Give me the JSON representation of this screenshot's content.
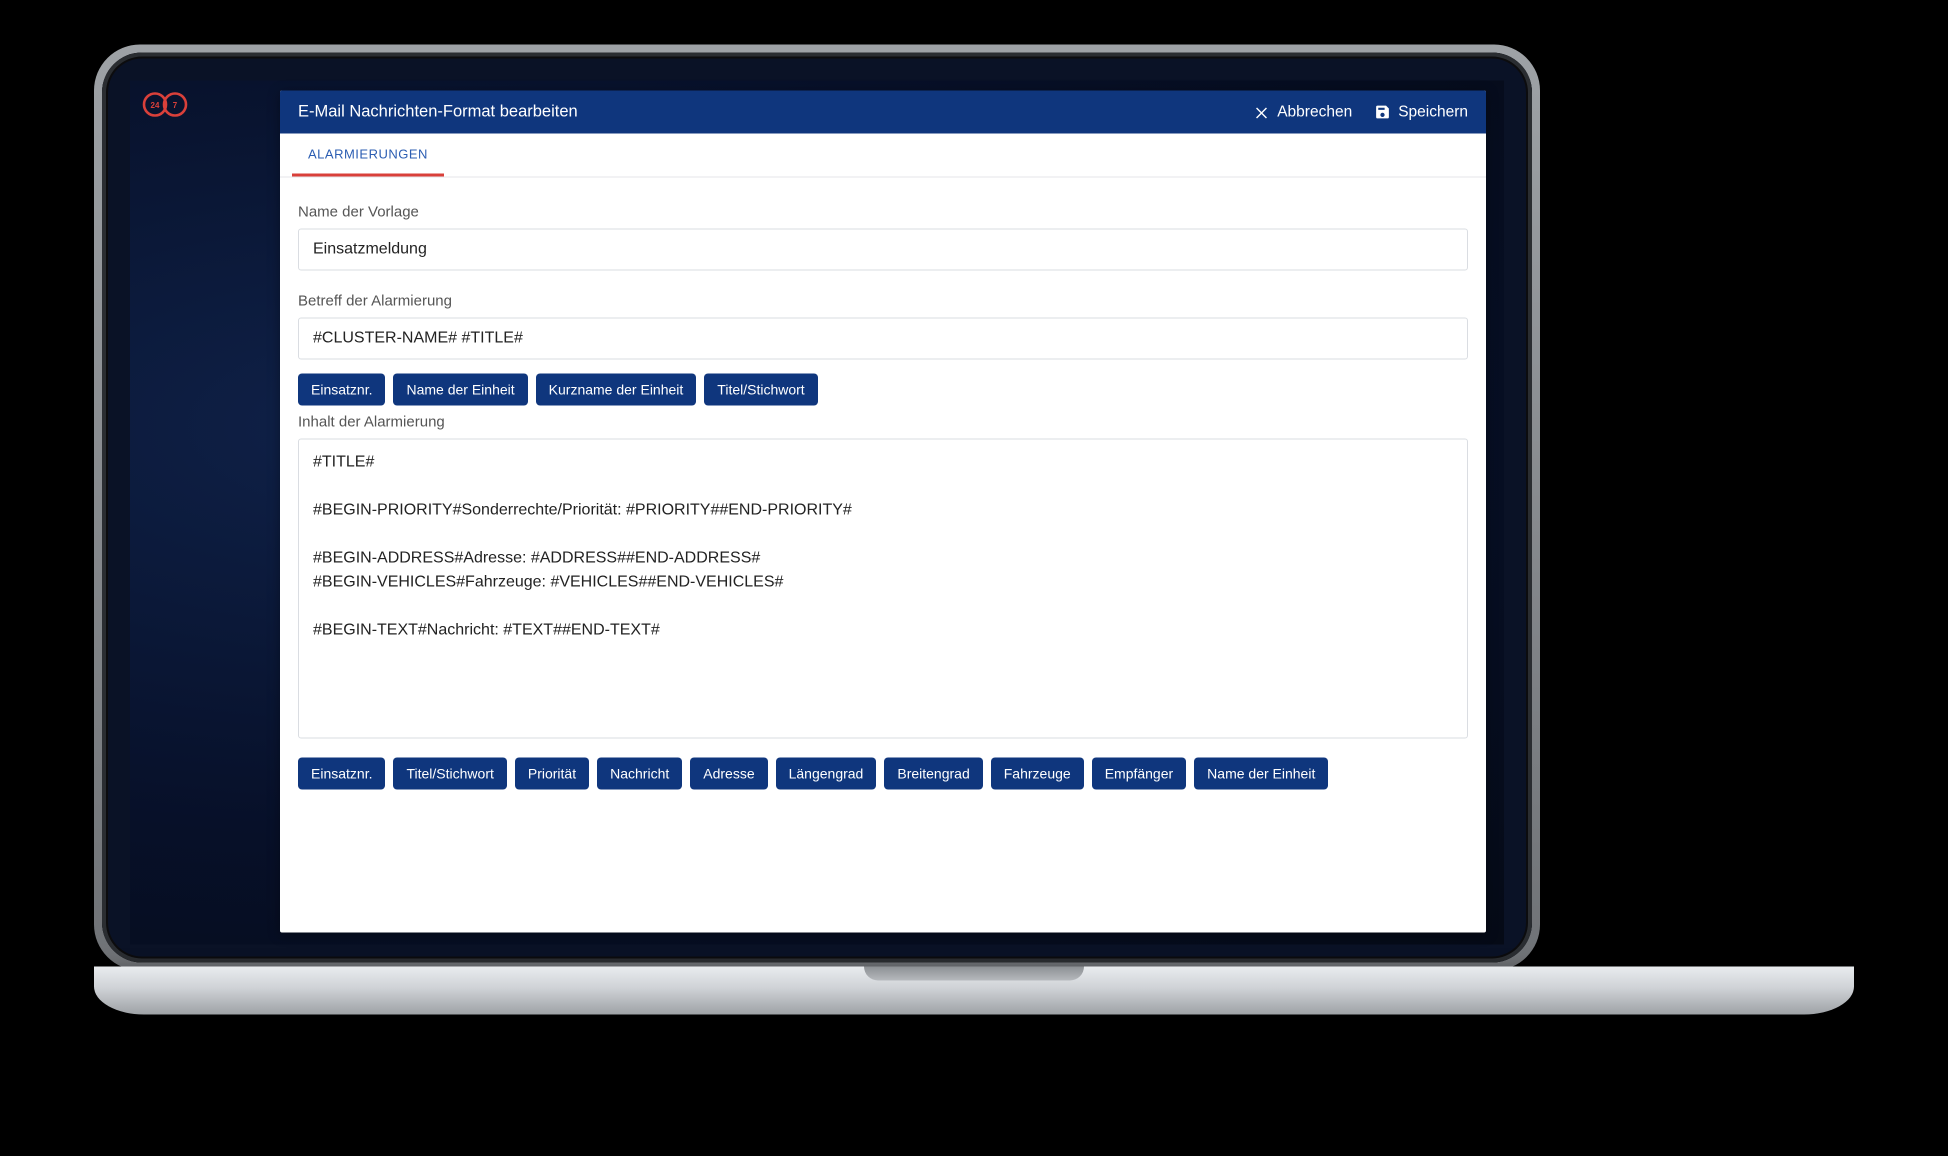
{
  "header": {
    "title": "E-Mail Nachrichten-Format bearbeiten",
    "cancel_label": "Abbrechen",
    "save_label": "Speichern"
  },
  "tabs": {
    "alarmierungen": "ALARMIERUNGEN"
  },
  "form": {
    "template_name_label": "Name der Vorlage",
    "template_name_value": "Einsatzmeldung",
    "subject_label": "Betreff der Alarmierung",
    "subject_value": "#CLUSTER-NAME# #TITLE#",
    "content_label": "Inhalt der Alarmierung",
    "content_value": "#TITLE#\n\n#BEGIN-PRIORITY#Sonderrechte/Priorität: #PRIORITY##END-PRIORITY#\n\n#BEGIN-ADDRESS#Adresse: #ADDRESS##END-ADDRESS#\n#BEGIN-VEHICLES#Fahrzeuge: #VEHICLES##END-VEHICLES#\n\n#BEGIN-TEXT#Nachricht: #TEXT##END-TEXT#"
  },
  "subject_chips": [
    "Einsatznr.",
    "Name der Einheit",
    "Kurzname der Einheit",
    "Titel/Stichwort"
  ],
  "content_chips": [
    "Einsatznr.",
    "Titel/Stichwort",
    "Priorität",
    "Nachricht",
    "Adresse",
    "Längengrad",
    "Breitengrad",
    "Fahrzeuge",
    "Empfänger",
    "Name der Einheit"
  ],
  "logo": {
    "left": "24",
    "right": "7"
  }
}
